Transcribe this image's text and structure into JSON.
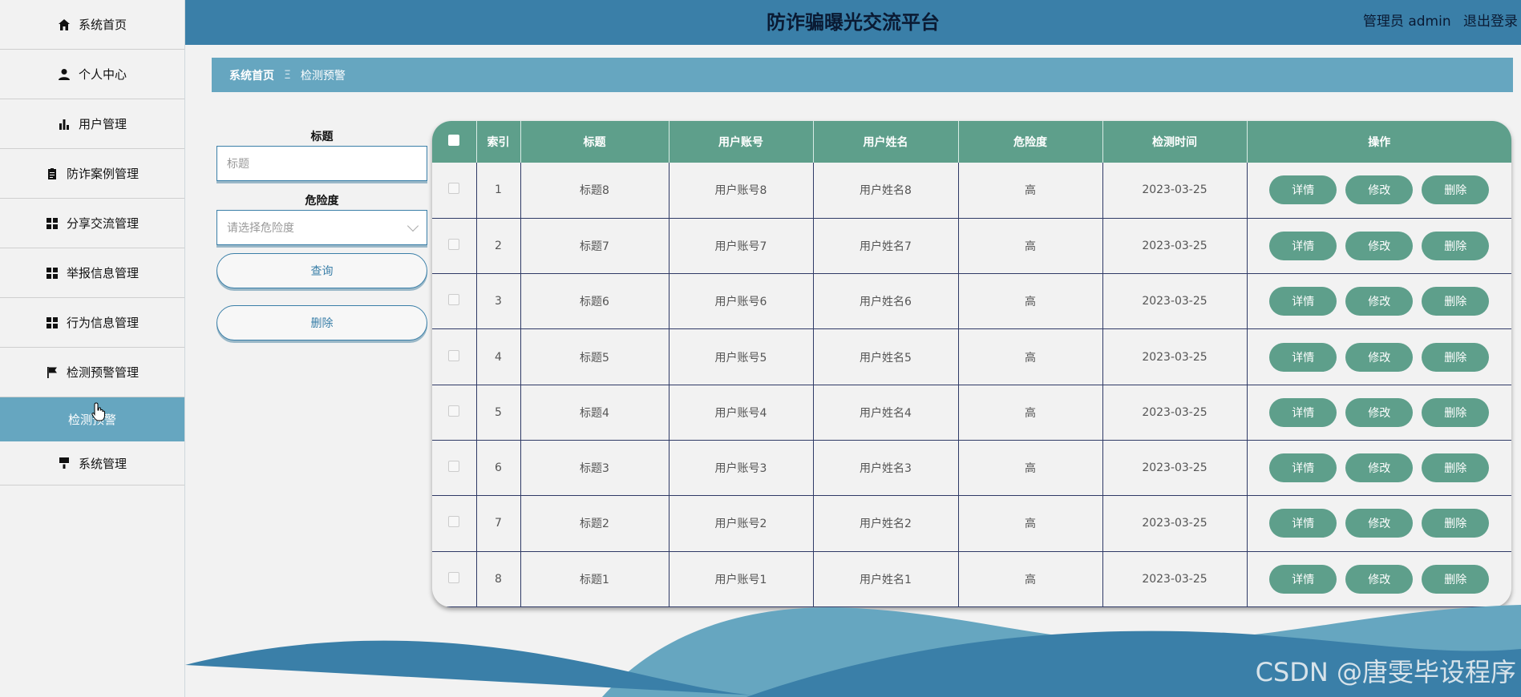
{
  "app": {
    "title": "防诈骗曝光交流平台",
    "user_label": "管理员 admin",
    "logout": "退出登录"
  },
  "sidebar": {
    "items": [
      {
        "label": "系统首页",
        "icon": "home-icon"
      },
      {
        "label": "个人中心",
        "icon": "person-icon"
      },
      {
        "label": "用户管理",
        "icon": "bar-chart-icon"
      },
      {
        "label": "防诈案例管理",
        "icon": "clipboard-icon"
      },
      {
        "label": "分享交流管理",
        "icon": "grid-icon"
      },
      {
        "label": "举报信息管理",
        "icon": "grid-icon"
      },
      {
        "label": "行为信息管理",
        "icon": "grid-icon"
      },
      {
        "label": "检测预警管理",
        "icon": "flag-icon"
      },
      {
        "label": "检测预警",
        "icon": ""
      },
      {
        "label": "系统管理",
        "icon": "brush-icon"
      }
    ]
  },
  "breadcrumb": {
    "home": "系统首页",
    "separator": "Ξ",
    "current": "检测预警"
  },
  "search": {
    "title_label": "标题",
    "title_placeholder": "标题",
    "risk_label": "危险度",
    "risk_placeholder": "请选择危险度",
    "query_button": "查询",
    "delete_button": "删除"
  },
  "table": {
    "headers": [
      "索引",
      "标题",
      "用户账号",
      "用户姓名",
      "危险度",
      "检测时间",
      "操作"
    ],
    "actions": [
      "详情",
      "修改",
      "删除"
    ],
    "rows": [
      {
        "index": "1",
        "title": "标题8",
        "account": "用户账号8",
        "name": "用户姓名8",
        "risk": "高",
        "time": "2023-03-25"
      },
      {
        "index": "2",
        "title": "标题7",
        "account": "用户账号7",
        "name": "用户姓名7",
        "risk": "高",
        "time": "2023-03-25"
      },
      {
        "index": "3",
        "title": "标题6",
        "account": "用户账号6",
        "name": "用户姓名6",
        "risk": "高",
        "time": "2023-03-25"
      },
      {
        "index": "4",
        "title": "标题5",
        "account": "用户账号5",
        "name": "用户姓名5",
        "risk": "高",
        "time": "2023-03-25"
      },
      {
        "index": "5",
        "title": "标题4",
        "account": "用户账号4",
        "name": "用户姓名4",
        "risk": "高",
        "time": "2023-03-25"
      },
      {
        "index": "6",
        "title": "标题3",
        "account": "用户账号3",
        "name": "用户姓名3",
        "risk": "高",
        "time": "2023-03-25"
      },
      {
        "index": "7",
        "title": "标题2",
        "account": "用户账号2",
        "name": "用户姓名2",
        "risk": "高",
        "time": "2023-03-25"
      },
      {
        "index": "8",
        "title": "标题1",
        "account": "用户账号1",
        "name": "用户姓名1",
        "risk": "高",
        "time": "2023-03-25"
      }
    ]
  },
  "watermark": "CSDN @唐雯毕设程序",
  "colors": {
    "header": "#3a7fa8",
    "accent": "#66a6c0",
    "table_green": "#5e9f8b"
  }
}
